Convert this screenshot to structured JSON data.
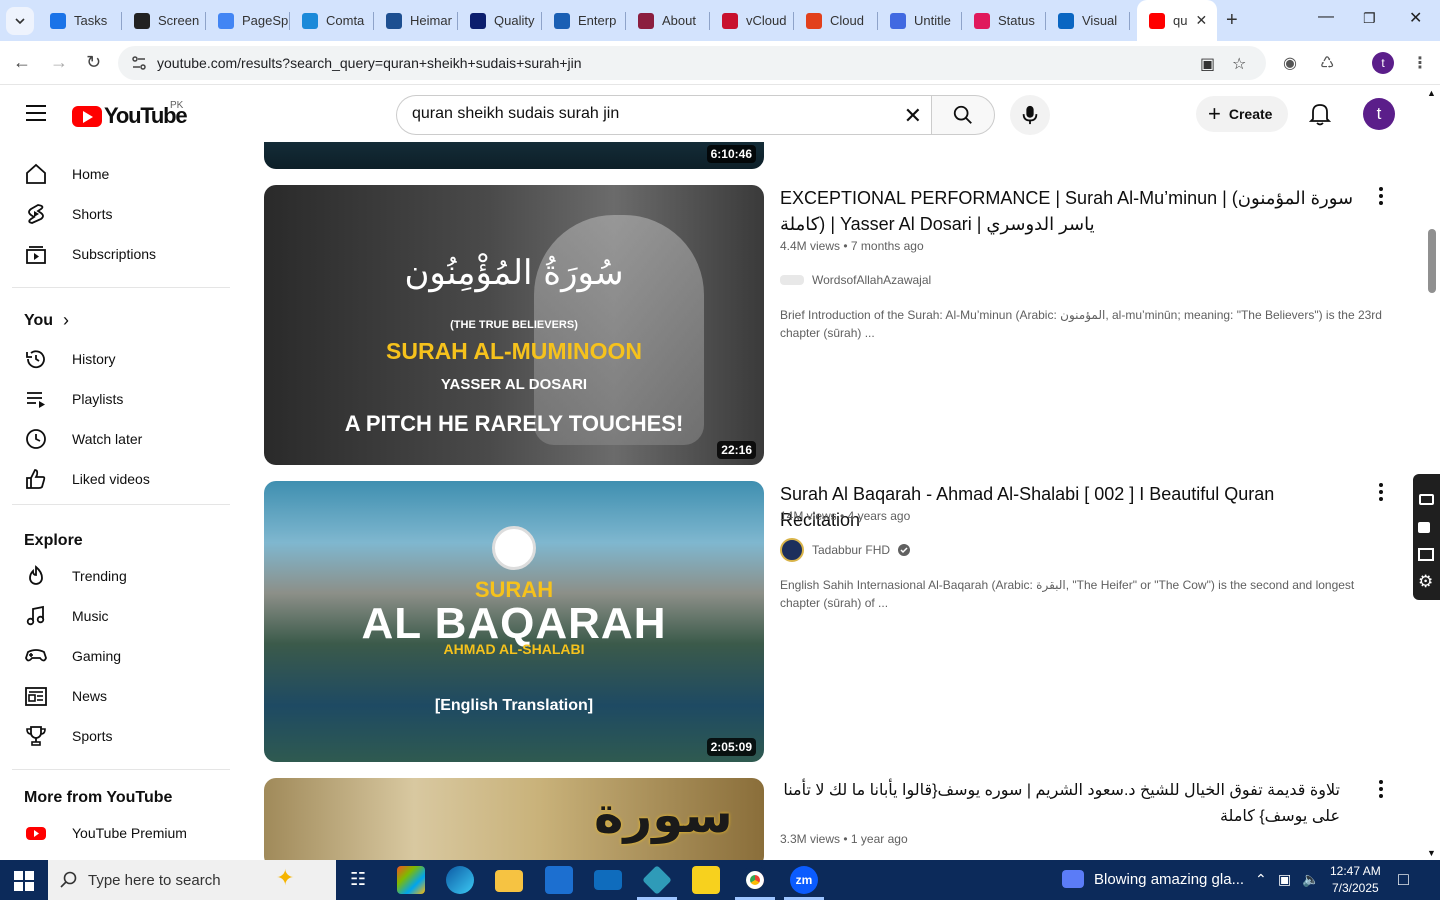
{
  "browser": {
    "tabs": [
      {
        "title": "Tasks",
        "color": "#1a73e8"
      },
      {
        "title": "Screen",
        "color": "#222222"
      },
      {
        "title": "PageSp",
        "color": "#4285f4"
      },
      {
        "title": "Comta",
        "color": "#1c8ad9"
      },
      {
        "title": "Heimar",
        "color": "#1d4f91"
      },
      {
        "title": "Quality",
        "color": "#0b1e6e"
      },
      {
        "title": "Enterp",
        "color": "#1a5fb4"
      },
      {
        "title": "About",
        "color": "#8b1e3f"
      },
      {
        "title": "vCloud",
        "color": "#c8102e"
      },
      {
        "title": "Cloud",
        "color": "#e2401c"
      },
      {
        "title": "Untitle",
        "color": "#4169e1"
      },
      {
        "title": "Status",
        "color": "#e0195c"
      },
      {
        "title": "Visual",
        "color": "#0a66c2"
      },
      {
        "title": "qu",
        "color": "#ff0000"
      }
    ],
    "url": "youtube.com/results?search_query=quran+sheikh+sudais+surah+jin"
  },
  "youtube": {
    "logo_text": "YouTube",
    "country_code": "PK",
    "search_query": "quran sheikh sudais surah jin",
    "create_label": "Create",
    "avatar_letter": "t"
  },
  "sidebar": {
    "main": [
      {
        "label": "Home",
        "icon": "home-icon"
      },
      {
        "label": "Shorts",
        "icon": "shorts-icon"
      },
      {
        "label": "Subscriptions",
        "icon": "subscriptions-icon"
      }
    ],
    "you_heading": "You",
    "you": [
      {
        "label": "History",
        "icon": "history-icon"
      },
      {
        "label": "Playlists",
        "icon": "playlists-icon"
      },
      {
        "label": "Watch later",
        "icon": "watch-later-icon"
      },
      {
        "label": "Liked videos",
        "icon": "liked-videos-icon"
      }
    ],
    "explore_heading": "Explore",
    "explore": [
      {
        "label": "Trending",
        "icon": "trending-icon"
      },
      {
        "label": "Music",
        "icon": "music-icon"
      },
      {
        "label": "Gaming",
        "icon": "gaming-icon"
      },
      {
        "label": "News",
        "icon": "news-icon"
      },
      {
        "label": "Sports",
        "icon": "sports-icon"
      }
    ],
    "more_heading": "More from YouTube",
    "more": [
      {
        "label": "YouTube Premium",
        "icon": "youtube-premium-icon"
      }
    ]
  },
  "results": {
    "prev_duration": "6:10:46",
    "videos": [
      {
        "title": "EXCEPTIONAL PERFORMANCE | Surah Al-Mu’minun | (سورة المؤمنون (كاملة | Yasser Al Dosari | ياسر الدوسري",
        "views": "4.4M views",
        "age": "7 months ago",
        "channel": "WordsofAllahAzawajal",
        "verified": false,
        "description": "Brief Introduction of the Surah: Al-Mu’minun (Arabic: المؤمنون, al-mu’minūn; meaning: \"The Believers\") is the 23rd chapter (sūrah) ...",
        "duration": "22:16",
        "thumb_lines": [
          "سُورَةُ المُؤْمِنُون",
          "(THE TRUE BELIEVERS)",
          "SURAH AL-MUMINOON",
          "YASSER AL DOSARI",
          "A PITCH HE RARELY TOUCHES!"
        ]
      },
      {
        "title": "Surah Al Baqarah - Ahmad Al-Shalabi [ 002 ] I Beautiful Quran Recitation",
        "views": "14M views",
        "age": "4 years ago",
        "channel": "Tadabbur FHD",
        "verified": true,
        "description": "English Sahih Internasional Al-Baqarah (Arabic: البقرة, \"The Heifer\" or \"The Cow\") is the second and longest chapter (sūrah) of ...",
        "duration": "2:05:09",
        "thumb_lines": [
          "SURAH",
          "AL BAQARAH",
          "AHMAD AL-SHALABI",
          "[English Translation]"
        ]
      },
      {
        "title": "تلاوة قديمة تفوق الخيال للشيخ د.سعود الشريم | سوره يوسف{قالوا يأبانا ما لك لا تأمنا على يوسف} كاملة",
        "views": "3.3M views",
        "age": "1 year ago",
        "thumb_lines": [
          "سورة"
        ]
      }
    ]
  },
  "taskbar": {
    "search_placeholder": "Type here to search",
    "notification_text": "Blowing amazing gla...",
    "time": "12:47 AM",
    "date": "7/3/2025"
  }
}
